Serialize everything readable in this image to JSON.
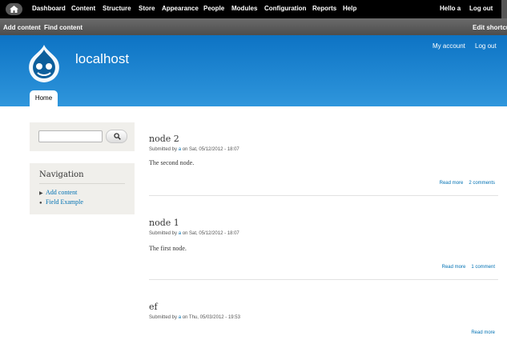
{
  "toolbar": {
    "items": [
      "Dashboard",
      "Content",
      "Structure",
      "Store",
      "Appearance",
      "People",
      "Modules",
      "Configuration",
      "Reports",
      "Help"
    ],
    "hello": "Hello a",
    "logout": "Log out"
  },
  "shortcuts": {
    "items": [
      "Add content",
      "Find content"
    ],
    "edit": "Edit shortcuts"
  },
  "header": {
    "site_name": "localhost",
    "my_account": "My account",
    "logout": "Log out",
    "tab_home": "Home"
  },
  "sidebar": {
    "nav_title": "Navigation",
    "nav_items": [
      "Add content",
      "Field Example"
    ]
  },
  "nodes": [
    {
      "title": "node 2",
      "meta_prefix": "Submitted by ",
      "user": "a",
      "meta_suffix": " on Sat, 05/12/2012 - 18:07",
      "body": "The second node.",
      "read_more": "Read more",
      "comments": "2 comments"
    },
    {
      "title": "node 1",
      "meta_prefix": "Submitted by ",
      "user": "a",
      "meta_suffix": " on Sat, 05/12/2012 - 18:07",
      "body": "The first node.",
      "read_more": "Read more",
      "comments": "1 comment"
    },
    {
      "title": "ef",
      "meta_prefix": "Submitted by ",
      "user": "a",
      "meta_suffix": " on Thu, 05/03/2012 - 19:53",
      "read_more": "Read more"
    }
  ],
  "colors": {
    "toolbar_bg": "#000000",
    "header_blue": "#1a85d0",
    "link_blue": "#0071b3",
    "sidebar_bg": "#f0efeb"
  }
}
